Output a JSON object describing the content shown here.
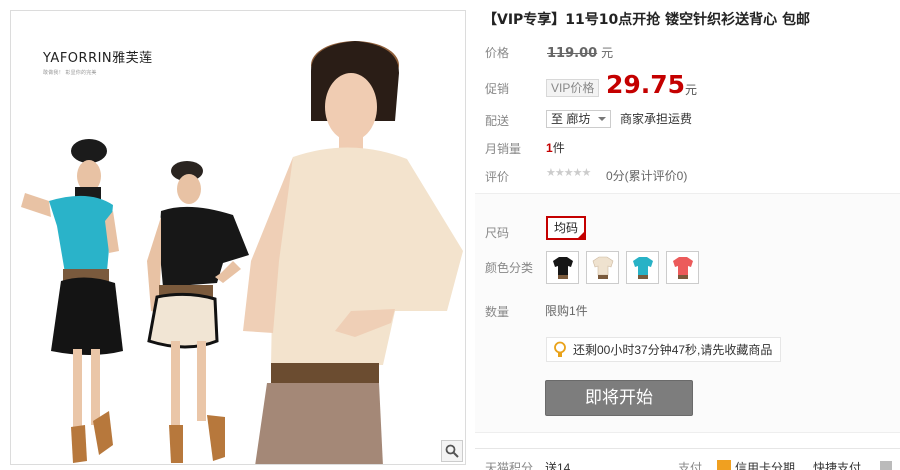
{
  "gallery": {
    "brand_name": "YAFORRIN雅芙莲",
    "brand_slogan": "敢做我！ 彰显你的完美"
  },
  "product": {
    "title": "【VIP专享】11号10点开抢 镂空针织衫送背心 包邮"
  },
  "rows": {
    "price_label": "价格",
    "original_price": "119.00",
    "price_unit": "元",
    "promo_label": "促销",
    "vip_tag": "VIP价格",
    "promo_price": "29.75",
    "promo_unit": "元",
    "shipping_label": "配送",
    "shipping_dest": "至 廊坊",
    "shipping_fee": "商家承担运费",
    "sales_label": "月销量",
    "sales_count": "1",
    "sales_unit": "件",
    "rating_label": "评价",
    "rating_stars": "★★★★★",
    "rating_text": "0分(累计评价0)"
  },
  "options": {
    "size_label": "尺码",
    "size_value": "均码",
    "color_label": "颜色分类",
    "colors": [
      "black",
      "cream",
      "turquoise",
      "coral"
    ],
    "qty_label": "数量",
    "qty_limit": "限购1件",
    "countdown_text": "还剩00小时37分钟47秒,请先收藏商品",
    "start_button": "即将开始"
  },
  "bottom": {
    "points_label": "天猫积分",
    "points_value": "送14",
    "pay_label": "支付",
    "credit_card": "信用卡分期",
    "quick_pay": "快捷支付"
  },
  "colors": {
    "accent_red": "#c40000",
    "button_gray": "#7d7d7d"
  }
}
